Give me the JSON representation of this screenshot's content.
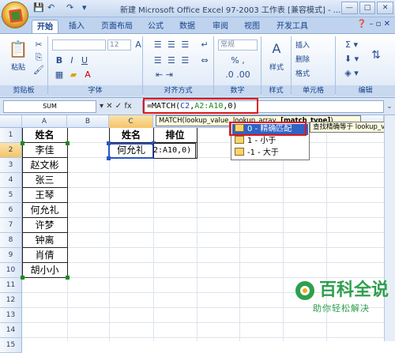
{
  "window": {
    "title": "新建 Microsoft Office Excel 97-2003 工作表 [兼容模式] - ...",
    "controls": [
      "—",
      "□",
      "✕"
    ]
  },
  "quick_access": [
    "💾",
    "↶",
    "↷",
    "▾"
  ],
  "tabs": [
    "开始",
    "插入",
    "页面布局",
    "公式",
    "数据",
    "审阅",
    "视图",
    "开发工具"
  ],
  "active_tab": "开始",
  "ribbon": {
    "groups": [
      "剪贴板",
      "字体",
      "对齐方式",
      "数字",
      "样式",
      "单元格",
      "编辑"
    ],
    "paste_label": "粘贴",
    "style_label": "样式",
    "font_size": "12",
    "number_format": "常规",
    "cells_buttons": [
      "插入",
      "删除",
      "格式"
    ]
  },
  "formula_bar": {
    "name_box": "SUM",
    "buttons": "▾ ✕ ✓ fx",
    "formula_prefix": "=MATCH(",
    "formula_ref1": "C2",
    "formula_mid": ",",
    "formula_ref2": "A2:A10",
    "formula_suffix": ",0)"
  },
  "tooltip": {
    "text": "MATCH(lookup_value, lookup_array, ",
    "bold": "[match_type]",
    "close": ")"
  },
  "autocomplete": {
    "items": [
      "0 - 精确匹配",
      "1 - 小于",
      "-1 - 大于"
    ],
    "selected_index": 0,
    "tip": "查找精确等于 lookup_value"
  },
  "columns": [
    "A",
    "B",
    "C",
    "D",
    "E",
    "F",
    "G",
    "H"
  ],
  "rows": [
    "1",
    "2",
    "3",
    "4",
    "5",
    "6",
    "7",
    "8",
    "9",
    "10",
    "11",
    "12",
    "13",
    "14",
    "15"
  ],
  "sheet": {
    "A": [
      "姓名",
      "李佳",
      "赵文彬",
      "张三",
      "王琴",
      "何允礼",
      "许梦",
      "钟离",
      "肖倩",
      "胡小小"
    ],
    "C1": "姓名",
    "D1": "排位",
    "C2": "何允礼",
    "D2": "2:A10,0)"
  },
  "watermark": {
    "title": "百科全说",
    "subtitle": "助你轻松解决"
  }
}
